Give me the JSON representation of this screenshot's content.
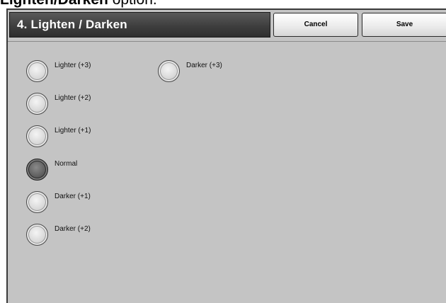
{
  "caption": {
    "bold_text": "Lighten/Darken",
    "rest_text": " option."
  },
  "header": {
    "title": "4. Lighten / Darken",
    "cancel_label": "Cancel",
    "save_label": "Save"
  },
  "options": {
    "lighter_3": {
      "label": "Lighter (+3)",
      "selected": false
    },
    "lighter_2": {
      "label": "Lighter (+2)",
      "selected": false
    },
    "lighter_1": {
      "label": "Lighter (+1)",
      "selected": false
    },
    "normal": {
      "label": "Normal",
      "selected": true
    },
    "darker_1": {
      "label": "Darker (+1)",
      "selected": false
    },
    "darker_2": {
      "label": "Darker (+2)",
      "selected": false
    },
    "darker_3": {
      "label": "Darker (+3)",
      "selected": false
    }
  },
  "selected_option": "Normal"
}
